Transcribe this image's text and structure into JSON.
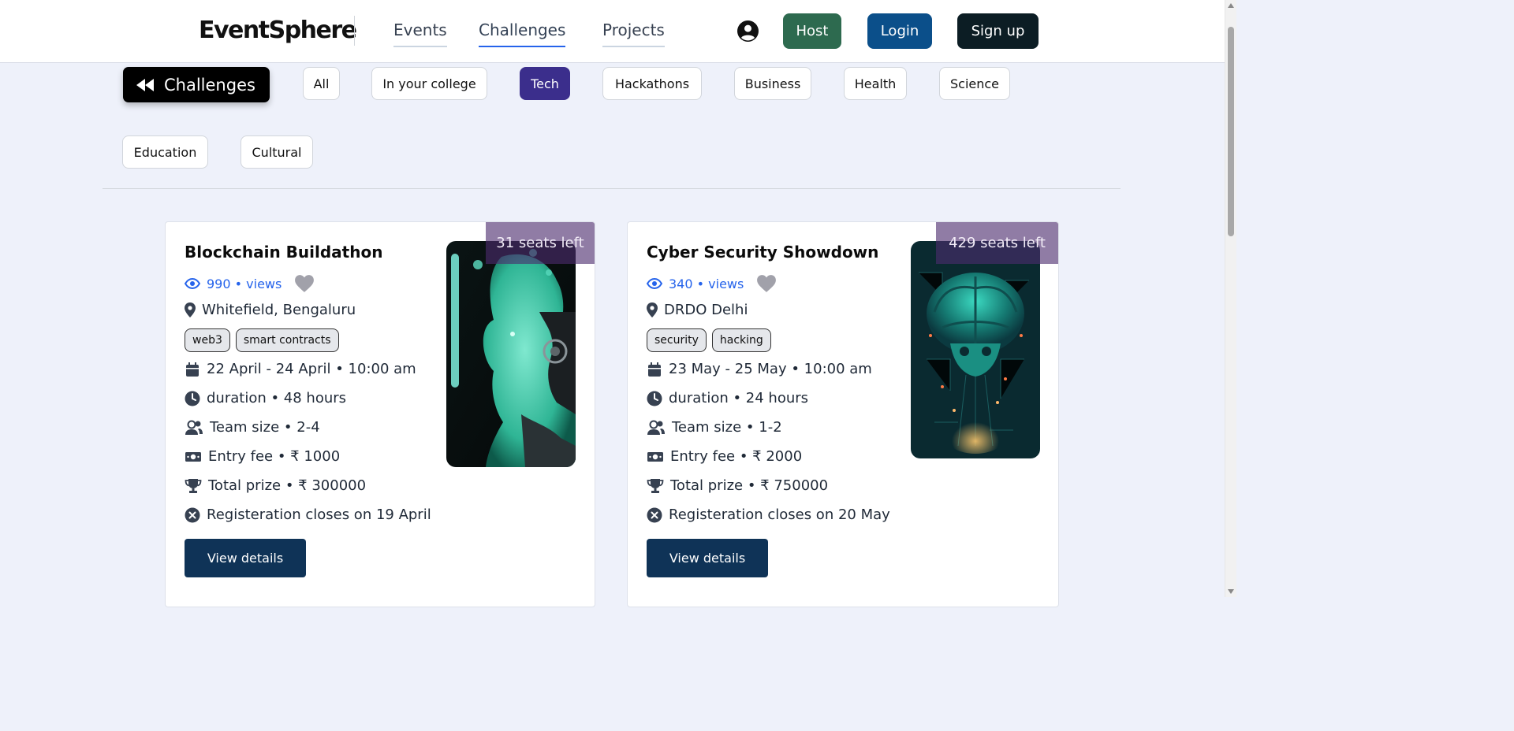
{
  "header": {
    "logo": "EventSphere",
    "nav": [
      "Events",
      "Challenges",
      "Projects"
    ],
    "active_nav": "Challenges",
    "buttons": {
      "host": "Host",
      "login": "Login",
      "signup": "Sign up"
    }
  },
  "filters": {
    "back_label": "Challenges",
    "chips": [
      "All",
      "In your college",
      "Tech",
      "Hackathons",
      "Business",
      "Health",
      "Science",
      "Education",
      "Cultural"
    ],
    "active_chip": "Tech"
  },
  "cards": [
    {
      "title": "Blockchain Buildathon",
      "views": "990 • views",
      "location": "Whitefield, Bengaluru",
      "tags": [
        "web3",
        "smart contracts"
      ],
      "dates": "22 April - 24 April • 10:00 am",
      "duration": "duration • 48 hours",
      "team_size": "Team size • 2-4",
      "entry_fee": "Entry fee • ₹ 1000",
      "total_prize": "Total prize • ₹ 300000",
      "registration": "Registeration closes on 19 April",
      "seats": "31 seats left",
      "button": "View details"
    },
    {
      "title": "Cyber Security Showdown",
      "views": "340 • views",
      "location": "DRDO Delhi",
      "tags": [
        "security",
        "hacking"
      ],
      "dates": "23 May - 25 May • 10:00 am",
      "duration": "duration • 24 hours",
      "team_size": "Team size • 1-2",
      "entry_fee": "Entry fee • ₹ 2000",
      "total_prize": "Total prize • ₹ 750000",
      "registration": "Registeration closes on 20 May",
      "seats": "429 seats left",
      "button": "View details"
    }
  ],
  "colors": {
    "page_bg": "#eef1fa",
    "host": "#2d6a4f",
    "login": "#0b4f8a",
    "signup": "#0c1d24",
    "active_chip": "#3b2e8c",
    "view_button": "#0f3357",
    "link_blue": "#2563eb"
  }
}
